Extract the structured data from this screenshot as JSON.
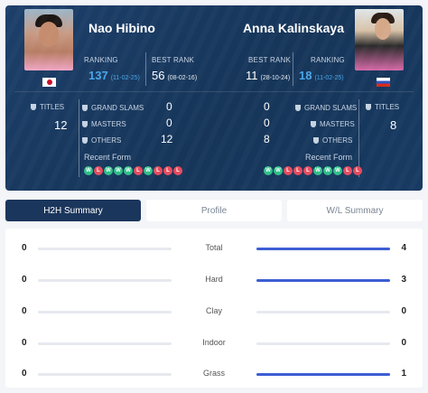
{
  "player1": {
    "name": "Nao Hibino",
    "flag": "jp-flag",
    "ranking_label": "RANKING",
    "ranking": "137",
    "ranking_date": "(11-02-25)",
    "best_rank_label": "BEST RANK",
    "best_rank": "56",
    "best_rank_date": "(08-02-16)",
    "titles_label": "TITLES",
    "titles": "12",
    "grand_slams": "0",
    "masters": "0",
    "others": "12",
    "recent_form": [
      "W",
      "L",
      "W",
      "W",
      "W",
      "L",
      "W",
      "L",
      "L",
      "L"
    ]
  },
  "player2": {
    "name": "Anna Kalinskaya",
    "flag": "ru-flag",
    "ranking_label": "RANKING",
    "ranking": "18",
    "ranking_date": "(11-02-25)",
    "best_rank_label": "BEST RANK",
    "best_rank": "11",
    "best_rank_date": "(28-10-24)",
    "titles_label": "TITLES",
    "titles": "8",
    "grand_slams": "0",
    "masters": "0",
    "others": "8",
    "recent_form": [
      "W",
      "W",
      "L",
      "L",
      "L",
      "W",
      "W",
      "W",
      "L",
      "L"
    ]
  },
  "labels": {
    "grand_slams": "GRAND SLAMS",
    "masters": "MASTERS",
    "others": "OTHERS",
    "recent_form": "Recent Form"
  },
  "tabs": [
    "H2H Summary",
    "Profile",
    "W/L Summary"
  ],
  "summary": [
    {
      "label": "Total",
      "p1": "0",
      "p2": "4",
      "p1_share": 0,
      "p2_share": 1
    },
    {
      "label": "Hard",
      "p1": "0",
      "p2": "3",
      "p1_share": 0,
      "p2_share": 1
    },
    {
      "label": "Clay",
      "p1": "0",
      "p2": "0",
      "p1_share": 0,
      "p2_share": 0
    },
    {
      "label": "Indoor",
      "p1": "0",
      "p2": "0",
      "p1_share": 0,
      "p2_share": 0
    },
    {
      "label": "Grass",
      "p1": "0",
      "p2": "1",
      "p1_share": 0,
      "p2_share": 1
    }
  ],
  "colors": {
    "win": "#2fc08a",
    "loss": "#e54b5e",
    "accent": "#49a6e9",
    "bar": "#3d5ed4",
    "header": "#1b365c"
  }
}
